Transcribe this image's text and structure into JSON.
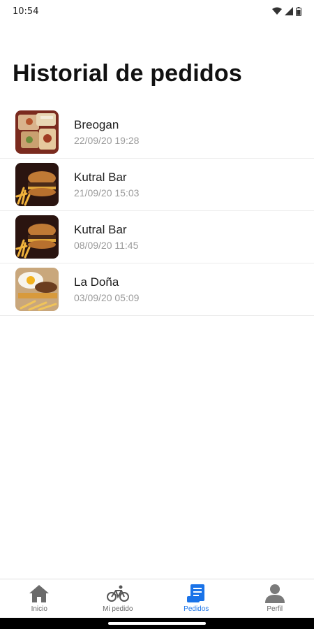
{
  "status_bar": {
    "time": "10:54",
    "icons": [
      "wifi-icon",
      "signal-icon",
      "battery-icon"
    ]
  },
  "page": {
    "title": "Historial de pedidos"
  },
  "orders": [
    {
      "name": "Breogan",
      "date": "22/09/20 19:28",
      "image": "platter-photo"
    },
    {
      "name": "Kutral Bar",
      "date": "21/09/20 15:03",
      "image": "burger-photo"
    },
    {
      "name": "Kutral Bar",
      "date": "08/09/20 11:45",
      "image": "burger-photo"
    },
    {
      "name": "La Doña",
      "date": "03/09/20 05:09",
      "image": "egg-burger-photo"
    }
  ],
  "bottom_nav": {
    "active": "Pedidos",
    "active_color": "#1a73e8",
    "items": [
      {
        "label": "Inicio",
        "icon": "home-icon"
      },
      {
        "label": "Mi pedido",
        "icon": "bicycle-icon"
      },
      {
        "label": "Pedidos",
        "icon": "receipt-icon"
      },
      {
        "label": "Perfil",
        "icon": "person-icon"
      }
    ]
  }
}
